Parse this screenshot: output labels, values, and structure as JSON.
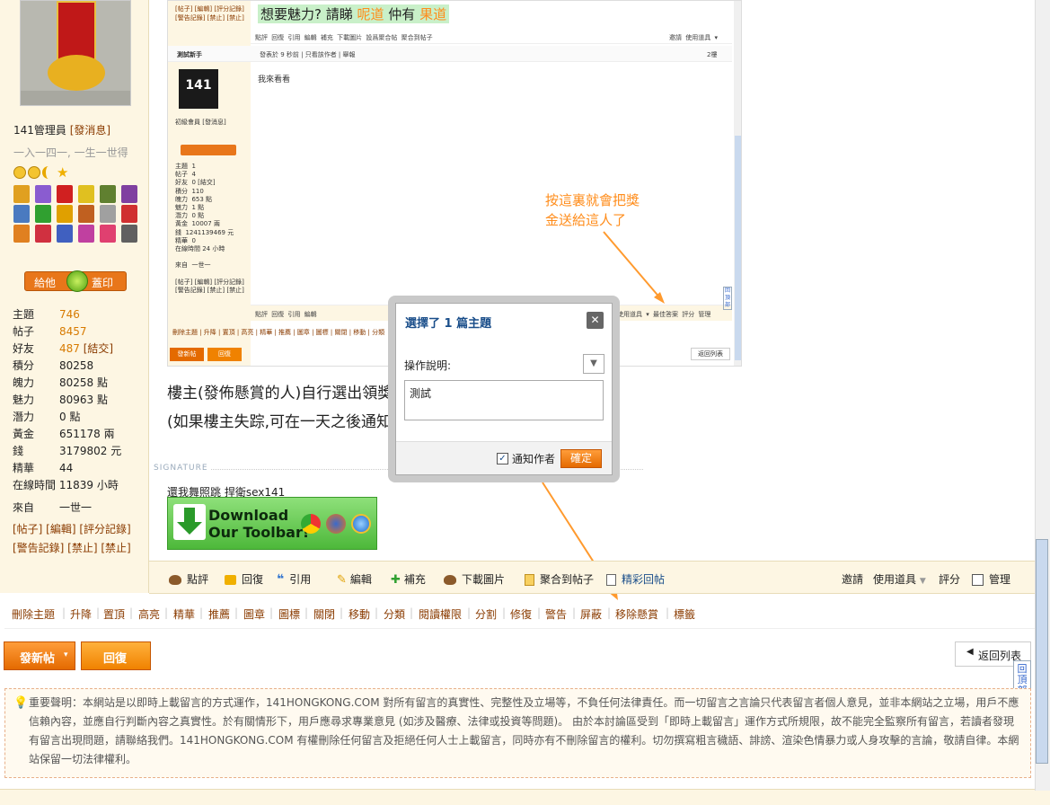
{
  "left": {
    "username": "141管理員",
    "send_msg": "[發消息]",
    "motto": "一入一四一, 一生一世得",
    "give_btn": "給他",
    "stamp_btn": "蓋印",
    "stats": [
      {
        "label": "主題",
        "value": "746",
        "orange": true
      },
      {
        "label": "帖子",
        "value": "8457",
        "orange": true
      },
      {
        "label": "好友",
        "value": "487",
        "orange": true,
        "extra": "[結交]"
      },
      {
        "label": "積分",
        "value": "80258"
      },
      {
        "label": "魄力",
        "value": "80258 點"
      },
      {
        "label": "魅力",
        "value": "80963 點"
      },
      {
        "label": "潛力",
        "value": "0 點"
      },
      {
        "label": "黃金",
        "value": "651178 兩"
      },
      {
        "label": "錢",
        "value": "3179802 元"
      },
      {
        "label": "精華",
        "value": "44"
      },
      {
        "label": "在線時間",
        "value": "11839 小時"
      }
    ],
    "from_label": "來自",
    "from_value": "一世一",
    "links1": "[帖子] [編輯] [評分記錄]",
    "links2": "[警告記錄] [禁止] [禁止]"
  },
  "embed": {
    "top_links1": "[帖子] [編輯] [評分記錄]",
    "top_links2": "[警告記錄] [禁止] [禁止]",
    "title_prefix": "想要魅力? 請睇 ",
    "title_a": "呢道",
    "title_mid": " 仲有 ",
    "title_b": "果道",
    "toolbar": "點評   回復   引用   編輯   補充   下載圖片   設爲聚合帖   聚合到帖子",
    "toolbar_right": "邀請  使用道具 ▾",
    "user": "測試新手",
    "posted": "發表於 9 秒前  |  只看該作者  |  舉報",
    "floor": "2樓",
    "body": "我來看看",
    "group": "初級會員 [發消息]",
    "stats": "主題  1\n帖子  4\n好友  0 [結交]\n積分  110\n魄力  653 點\n魅力  1 點\n潛力  0 點\n黃金  10007 兩\n錢  1241139469 元\n精華  0\n在線時間 24 小時\n\n來自  一世一\n\n[帖子] [編輯] [評分記錄]\n[警告記錄] [禁止] [禁止]",
    "bottom_toolbar": "點評   回復   引用   編輯",
    "bottom_right": "使用道具 ▾   最佳答案   評分   管理",
    "mod_links": "刪除主題 | 升降 | 置頂 | 高亮 | 精華 | 推薦 | 圖章 | 圖標 | 關閉 | 移動 | 分類",
    "post_btn": "發新帖",
    "reply_btn": "回復",
    "back": "返回列表",
    "totop": "回頂部"
  },
  "annotation": "按這裏就會把獎\n金送給這人了",
  "bigtext1": "樓主(發佈懸賞的人)自行選出領獎",
  "bigtext2": "(如果樓主失踪,可在一天之後通知",
  "signature": {
    "label": "SIGNATURE",
    "text": "還我舞照跳   捍衛sex141",
    "banner_line1": "Download",
    "banner_line2": "Our Toolbar!"
  },
  "toolbar": {
    "items": [
      "點評",
      "回復",
      "引用",
      "編輯",
      "補充",
      "下載圖片",
      "聚合到帖子",
      "精彩回帖"
    ],
    "right": [
      "邀請",
      "使用道具",
      "評分",
      "管理"
    ]
  },
  "mod_bar": [
    "刪除主題",
    "升降",
    "置頂",
    "高亮",
    "精華",
    "推薦",
    "圖章",
    "圖標",
    "關閉",
    "移動",
    "分類",
    "閱讀權限",
    "分割",
    "修復",
    "警告",
    "屏蔽",
    "移除懸賞",
    "標籤"
  ],
  "buttons": {
    "post": "發新帖",
    "post_arrow": "▾",
    "reply": "回復",
    "back": "返回列表",
    "totop": "回頂部"
  },
  "disclaimer": "重要聲明：本網站是以即時上載留言的方式運作，141HONGKONG.COM 對所有留言的真實性、完整性及立場等，不負任何法律責任。而一切留言之言論只代表留言者個人意見，並非本網站之立場，用戶不應信賴內容，並應自行判斷內容之真實性。於有關情形下，用戶應尋求專業意見 (如涉及醫療、法律或投資等問題)。 由於本討論區受到「即時上載留言」運作方式所規限，故不能完全監察所有留言，若讀者發現有留言出現問題，請聯絡我們。141HONGKONG.COM 有權刪除任何留言及拒絕任何人士上載留言，同時亦有不刪除留言的權利。切勿撰寫粗言穢語、誹謗、渲染色情暴力或人身攻擊的言論，敬請自律。本網站保留一切法律權利。",
  "dialog": {
    "title": "選擇了 1 篇主題",
    "close": "✕",
    "label": "操作說明:",
    "textarea": "測試",
    "notify": "通知作者",
    "confirm": "確定"
  },
  "colors": {
    "accent_orange": "#ff8c1a",
    "link_brown": "#8a3b00",
    "dialog_title": "#1a4e8a"
  }
}
